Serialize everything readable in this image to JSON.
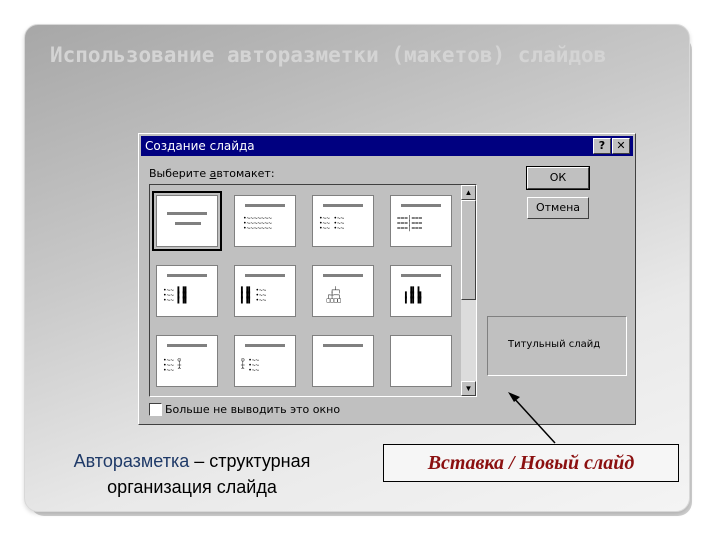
{
  "slide": {
    "title": "Использование авторазметки (макетов) слайдов"
  },
  "dialog": {
    "title": "Создание слайда",
    "help_button": "?",
    "close_button": "✕",
    "layout_label_prefix": "Выберите ",
    "layout_label_underlined": "а",
    "layout_label_suffix": "втомакет:",
    "ok_button": "ОК",
    "cancel_button": "Отмена",
    "preview_text": "Титульный слайд",
    "checkbox_label": "Больше не выводить это окно",
    "scroll_up": "▲",
    "scroll_down": "▼"
  },
  "captions": {
    "left_highlight": "Авторазметка",
    "left_rest_line1": " – структурная",
    "left_line2": "организация слайда",
    "right": "Вставка / Новый слайд"
  }
}
